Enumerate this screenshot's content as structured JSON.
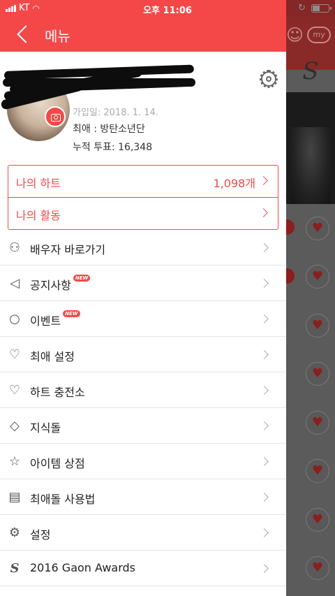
{
  "status_bar": {
    "carrier": "KT",
    "time": "오후 11:06"
  },
  "header": {
    "title": "메뉴"
  },
  "profile": {
    "join_date": "가입일: 2018. 1. 14.",
    "favorite": "최애 : 방탄소년단",
    "total_votes": "누적 투표: 16,348"
  },
  "hearts": {
    "my_heart_label": "나의 하트",
    "my_heart_count": "1,098개",
    "my_activity_label": "나의 활동"
  },
  "menu": [
    {
      "label": "배우자 바로가기",
      "icon": "spouse-icon",
      "new": false
    },
    {
      "label": "공지사항",
      "icon": "megaphone-icon",
      "new": true
    },
    {
      "label": "이벤트",
      "icon": "balloon-icon",
      "new": true
    },
    {
      "label": "최애 설정",
      "icon": "heart-arrow-icon",
      "new": false
    },
    {
      "label": "하트 충전소",
      "icon": "heart-charge-icon",
      "new": false
    },
    {
      "label": "지식돌",
      "icon": "graduation-cap-icon",
      "new": false
    },
    {
      "label": "아이템 상점",
      "icon": "medal-icon",
      "new": false
    },
    {
      "label": "최애돌 사용법",
      "icon": "map-icon",
      "new": false
    },
    {
      "label": "설정",
      "icon": "gear-icon",
      "new": false
    },
    {
      "label": "2016 Gaon Awards",
      "icon": "gaon-logo-icon",
      "new": false
    }
  ],
  "new_badge": "NEW",
  "colors": {
    "accent": "#f44848",
    "divider": "#e6e6e6"
  }
}
